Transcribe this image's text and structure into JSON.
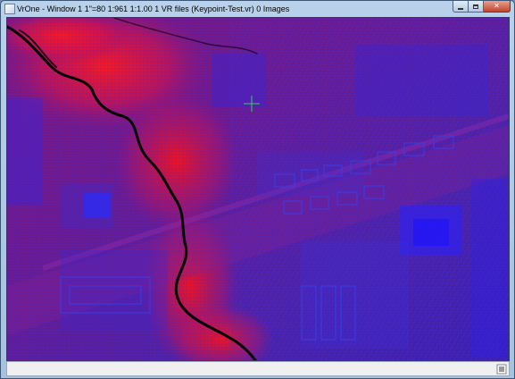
{
  "window": {
    "title": "VrOne - Window 1   1\"=80    1:961    1:1.00    1 VR files (Keypoint-Test.vr)    0 Images",
    "buttons": {
      "minimize": "minimize-icon",
      "maximize": "maximize-icon",
      "close": "close-icon"
    }
  },
  "viewport": {
    "content": "point-cloud-intensity-view",
    "colors": {
      "base": "#5a1e96",
      "high": "#ff1010",
      "low": "#2030ff",
      "void": "#000000"
    }
  },
  "statusbar": {
    "icon": "resize-grip-icon"
  }
}
